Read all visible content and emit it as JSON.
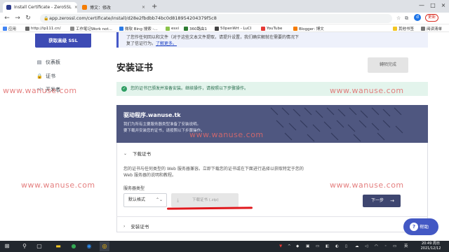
{
  "browser": {
    "tabs": [
      {
        "title": "Install Certificate - ZeroSSL",
        "close": "×",
        "color": "#2d3b8c"
      },
      {
        "title": "博文：修改",
        "close": "×",
        "color": "#f57c00"
      }
    ],
    "new_tab": "+",
    "window_controls": [
      "—",
      "□",
      "×"
    ],
    "url": "app.zerossl.com/certificate/install/d28e2fbdbb74bc0d818954204379f5c8",
    "update_label": "更新",
    "profile_initial": "d",
    "bookmarks": [
      {
        "label": "应用",
        "color": "#4285f4"
      },
      {
        "label": "http://ip111.cn/",
        "color": "#666666"
      },
      {
        "label": "工作笔记Work not...",
        "color": "#888888"
      },
      {
        "label": "微软 Bing 搜索 -...",
        "color": "#2c7be5"
      },
      {
        "label": "esxi",
        "color": "#8bc34a"
      },
      {
        "label": "360路由1",
        "color": "#2e7d32"
      },
      {
        "label": "50penWrt - LuCI",
        "color": "#444444"
      },
      {
        "label": "YouTube",
        "color": "#e53935"
      },
      {
        "label": "Blogger: 博文",
        "color": "#f57c00"
      }
    ],
    "bookmarks_right": [
      "其他书签",
      "阅读清单"
    ]
  },
  "sidebar": {
    "top_button": "获取高级 SSL",
    "items": [
      {
        "icon": "▤",
        "label": "仪表板"
      },
      {
        "icon": "🔒",
        "label": "证书"
      },
      {
        "icon": "</>",
        "label": "开发者"
      }
    ]
  },
  "notice": {
    "text": "了您作任何回以和文件（对于这些文本文件提取，请提升设置，我们确实解就在需要的情况下",
    "text2": "复了信证行为。",
    "link": "了解更多。"
  },
  "page": {
    "title": "安装证书",
    "next_top": "轉陌完成",
    "success_msg": "您的证书已颁发并准备安装。继续操作，请按照以下步骤操作。"
  },
  "card": {
    "title": "驱动程序.wanuse.tk",
    "sub1": "我们为所有主要服务器类型准备了安装说明。",
    "sub2": "要下载并安装您的证书，请按照以下步骤操作。"
  },
  "section1": {
    "title": "下载证书",
    "line1": "您的证书与任何类型的 Web 服务器兼容。立即下载您的证书或在下面进行选择以获取特定于您的",
    "line2": "Web 服务器的说明和教程。",
    "server_label": "服务器类型",
    "server_value": "默认格式",
    "download_label": "下载证书 (.zip)",
    "next_label": "下一步"
  },
  "section2": {
    "title": "安装证书"
  },
  "help": {
    "label": "帮助"
  },
  "watermark": "www.wanuse.com",
  "taskbar": {
    "time": "20:49 周日",
    "date": "2021/12/12",
    "lang": "英"
  }
}
